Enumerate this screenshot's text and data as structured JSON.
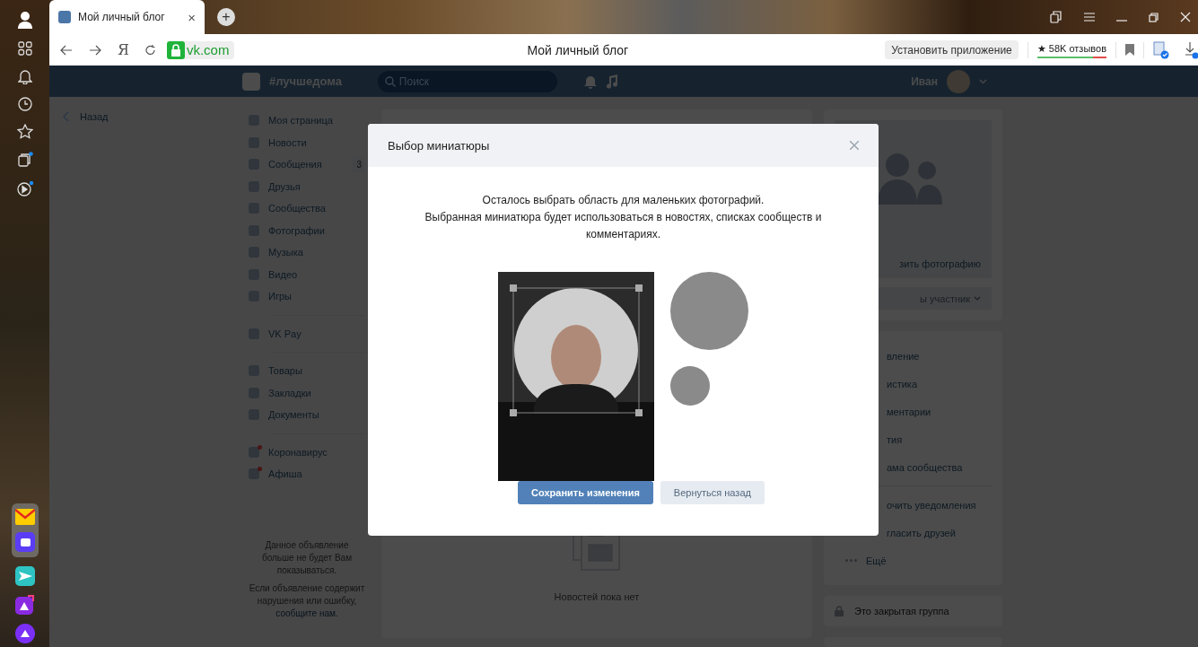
{
  "browser": {
    "tab_title": "Мой личный блог",
    "tab_close": "×",
    "new_tab": "+",
    "url": "vk.com",
    "page_title": "Мой личный блог",
    "install_button": "Установить приложение",
    "reviews": "★ 58K отзывов",
    "nav_letter": "Я"
  },
  "vk_header": {
    "hashtag": "#лучшедома",
    "search": {
      "placeholder": "Поиск"
    },
    "user_name": "Иван"
  },
  "back_link": "Назад",
  "nav_groups": [
    [
      {
        "label": "Моя страница"
      },
      {
        "label": "Новости"
      },
      {
        "label": "Сообщения",
        "badge": "3"
      },
      {
        "label": "Друзья"
      },
      {
        "label": "Сообщества"
      },
      {
        "label": "Фотографии"
      },
      {
        "label": "Музыка"
      },
      {
        "label": "Видео"
      },
      {
        "label": "Игры"
      }
    ],
    [
      {
        "label": "VK Pay"
      }
    ],
    [
      {
        "label": "Товары"
      },
      {
        "label": "Закладки"
      },
      {
        "label": "Документы"
      }
    ],
    [
      {
        "label": "Коронавирус",
        "dot": true
      },
      {
        "label": "Афиша",
        "dot": true
      }
    ]
  ],
  "ad_note": {
    "line_1": "Данное объявление больше не будет Вам показываться.",
    "line_2": "Если объявление содержит нарушения или ошибку,",
    "link": "сообщите нам."
  },
  "feed": {
    "empty_text": "Новостей пока нет"
  },
  "right_panel": {
    "upload_link": "зить фотографию",
    "member_button": "ы участник",
    "menu": [
      {
        "label": "вление",
        "separator_before": false
      },
      {
        "label": "истика",
        "separator_before": false
      },
      {
        "label": "ментарии",
        "separator_before": false
      },
      {
        "label": "тия",
        "separator_before": false
      },
      {
        "label": "ама сообщества",
        "separator_before": false
      },
      {
        "label": "очить уведомления",
        "separator_before": true
      },
      {
        "label": "гласить друзей",
        "separator_before": false
      }
    ],
    "more": "Ещё",
    "closed_group": "Это закрытая группа"
  },
  "modal": {
    "title": "Выбор миниатюры",
    "line_1": "Осталось выбрать область для маленьких фотографий.",
    "line_2": "Выбранная миниатюра будет использоваться в новостях, списках сообществ и комментариях.",
    "save_button": "Сохранить изменения",
    "back_button": "Вернуться назад"
  }
}
